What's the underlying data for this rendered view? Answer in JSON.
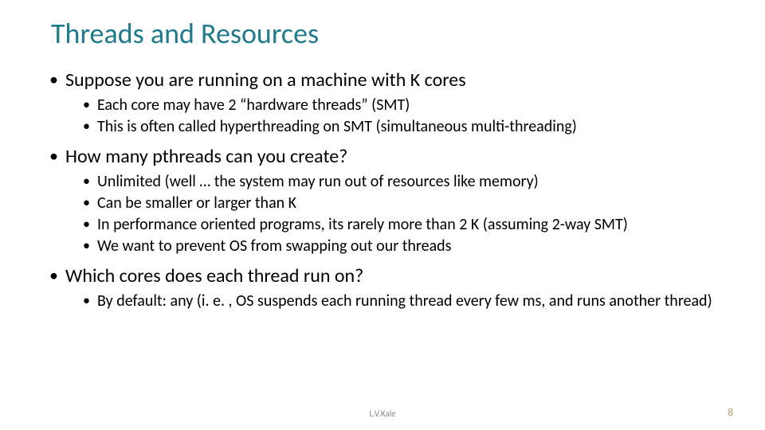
{
  "title": "Threads and Resources",
  "bullets": {
    "b1": "Suppose you are running on a machine with K cores",
    "b1_1": "Each core may have 2 “hardware threads” (SMT)",
    "b1_2": "This is often called hyperthreading on SMT (simultaneous multi-threading)",
    "b2": "How many pthreads can you create?",
    "b2_1": "Unlimited (well … the system may run out of resources like memory)",
    "b2_2": "Can be smaller or larger than K",
    "b2_3": "In performance oriented programs, its rarely more than 2 K (assuming 2-way SMT)",
    "b2_4": "We want to prevent OS from swapping out our threads",
    "b3": "Which cores does each thread run on?",
    "b3_1": "By default: any (i. e. , OS suspends each running thread every few ms, and runs another thread)"
  },
  "footer": {
    "author": "L.V.Kale",
    "page": "8"
  }
}
